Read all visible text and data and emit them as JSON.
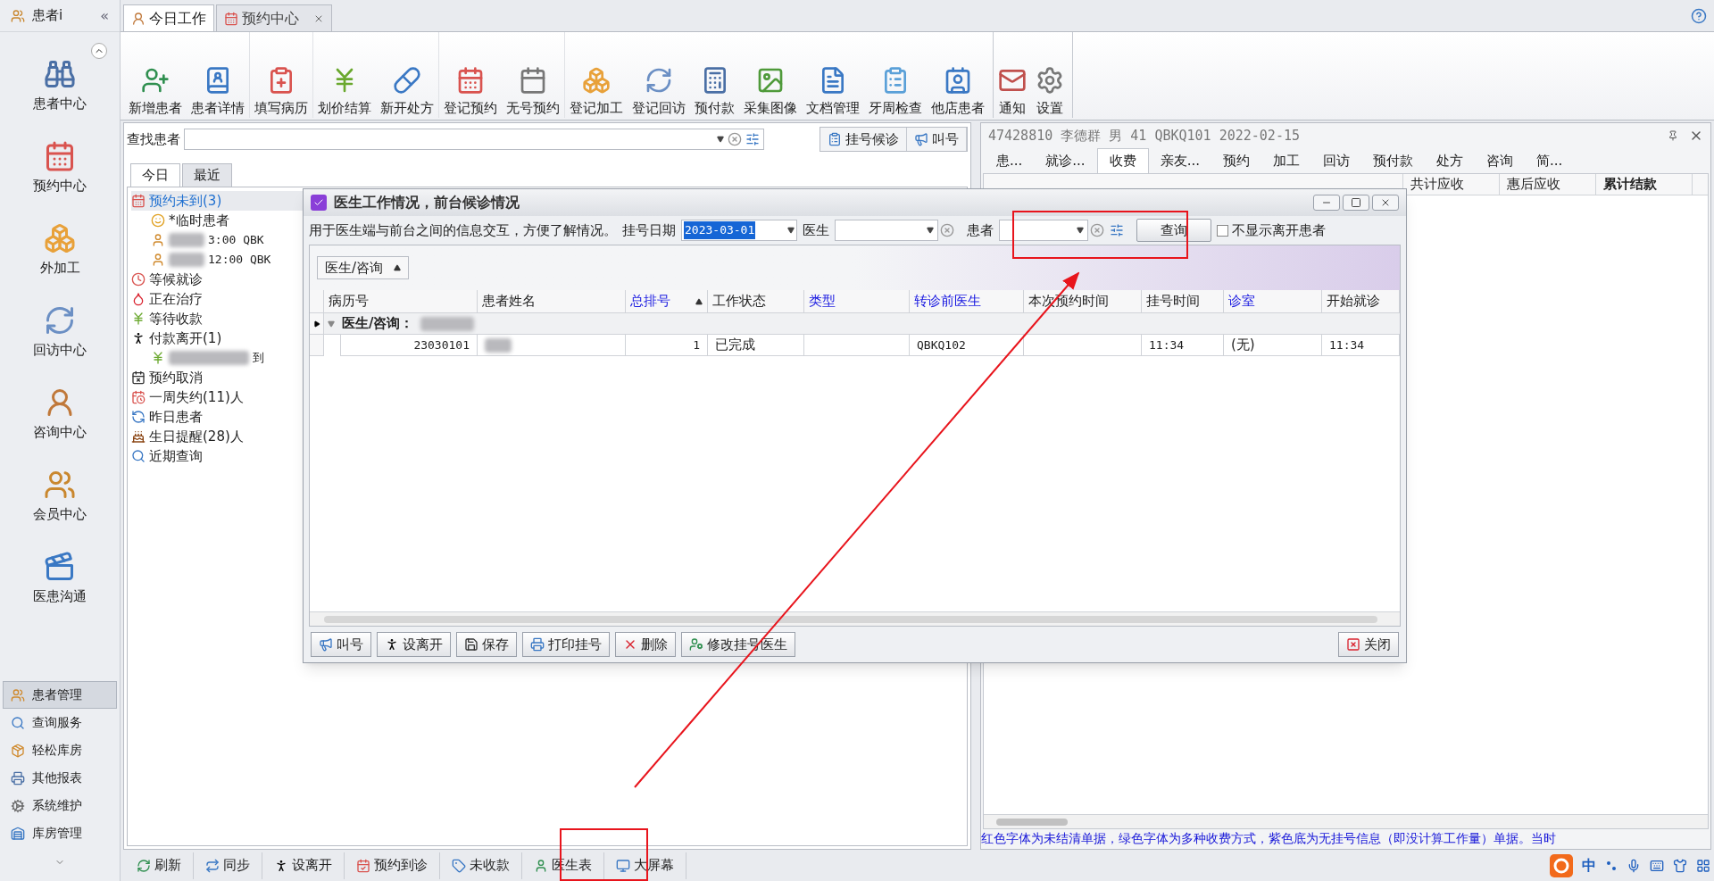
{
  "sidebar": {
    "title": "患者i",
    "collapse": "«",
    "nav": [
      {
        "label": "患者中心"
      },
      {
        "label": "预约中心"
      },
      {
        "label": "外加工"
      },
      {
        "label": "回访中心"
      },
      {
        "label": "咨询中心"
      },
      {
        "label": "会员中心"
      },
      {
        "label": "医患沟通"
      }
    ],
    "modules": [
      {
        "label": "患者管理",
        "selected": true
      },
      {
        "label": "查询服务",
        "selected": false
      },
      {
        "label": "轻松库房",
        "selected": false
      },
      {
        "label": "其他报表",
        "selected": false
      },
      {
        "label": "系统维护",
        "selected": false
      },
      {
        "label": "库房管理",
        "selected": false
      }
    ]
  },
  "doc_tabs": [
    {
      "label": "今日工作",
      "selected": true,
      "closable": false
    },
    {
      "label": "预约中心",
      "selected": false,
      "closable": true
    }
  ],
  "ribbon": [
    [
      "新增患者",
      "患者详情"
    ],
    [
      "填写病历"
    ],
    [
      "划价结算",
      "新开处方"
    ],
    [
      "登记预约",
      "无号预约"
    ],
    [
      "登记加工",
      "登记回访",
      "预付款",
      "采集图像",
      "文档管理",
      "牙周检查",
      "他店患者"
    ],
    [
      "通知",
      "设置"
    ]
  ],
  "left_panel": {
    "search_label": "查找患者",
    "buttons": [
      "挂号候诊",
      "叫号"
    ],
    "tabs": [
      {
        "label": "今日",
        "selected": true
      },
      {
        "label": "最近",
        "selected": false
      }
    ],
    "tree": [
      {
        "label": "预约未到(3)",
        "selected": true,
        "children": [
          {
            "label": "*临时患者",
            "blurred": false
          },
          {
            "label": "3:00 QBK",
            "blurred": true
          },
          {
            "label": "12:00 QBK",
            "blurred": true
          }
        ]
      },
      {
        "label": "等候就诊",
        "selected": false
      },
      {
        "label": "正在治疗",
        "selected": false
      },
      {
        "label": "等待收款",
        "selected": false
      },
      {
        "label": "付款离开(1)",
        "selected": false,
        "children": [
          {
            "label": "到",
            "blurred": true
          }
        ]
      },
      {
        "label": "预约取消",
        "selected": false
      },
      {
        "label": "一周失约(11)人",
        "selected": false
      },
      {
        "label": "昨日患者",
        "selected": false
      },
      {
        "label": "生日提醒(28)人",
        "selected": false
      },
      {
        "label": "近期查询",
        "selected": false
      }
    ]
  },
  "right_panel": {
    "title": "47428810 李德群 男 41 QBKQ101 2022-02-15",
    "tabs": [
      {
        "label": "患...",
        "selected": false
      },
      {
        "label": "就诊...",
        "selected": false
      },
      {
        "label": "收费",
        "selected": true
      },
      {
        "label": "亲友...",
        "selected": false
      },
      {
        "label": "预约",
        "selected": false
      },
      {
        "label": "加工",
        "selected": false
      },
      {
        "label": "回访",
        "selected": false
      },
      {
        "label": "预付款",
        "selected": false
      },
      {
        "label": "处方",
        "selected": false
      },
      {
        "label": "咨询",
        "selected": false
      },
      {
        "label": "简...",
        "selected": false
      }
    ],
    "columns": [
      {
        "label": "共计应收",
        "bold": false
      },
      {
        "label": "惠后应收",
        "bold": false
      },
      {
        "label": "累计结款",
        "bold": true
      }
    ],
    "status": "红色字体为未结清单据，绿色字体为多种收费方式，紫色底为无挂号信息（即没计算工作量）单据。当时"
  },
  "dialog": {
    "title": "医生工作情况，前台候诊情况",
    "description": "用于医生端与前台之间的信息交互，方便了解情况。",
    "date": {
      "label": "挂号日期",
      "value": "2023-03-01",
      "selected": true
    },
    "doctor_label": "医生",
    "patient_label": "患者",
    "query_button": "查询",
    "checkbox": {
      "label": "不显示离开患者",
      "checked": false
    },
    "group_by": "医生/咨询",
    "columns": [
      {
        "label": "病历号",
        "emphasized": false,
        "sorted": false
      },
      {
        "label": "患者姓名",
        "emphasized": false,
        "sorted": false
      },
      {
        "label": "总排号",
        "emphasized": true,
        "sorted": true
      },
      {
        "label": "工作状态",
        "emphasized": false,
        "sorted": false
      },
      {
        "label": "类型",
        "emphasized": true,
        "sorted": false
      },
      {
        "label": "转诊前医生",
        "emphasized": true,
        "sorted": false
      },
      {
        "label": "本次预约时间",
        "emphasized": false,
        "sorted": false
      },
      {
        "label": "挂号时间",
        "emphasized": false,
        "sorted": false
      },
      {
        "label": "诊室",
        "emphasized": true,
        "sorted": false
      },
      {
        "label": "开始就诊",
        "emphasized": false,
        "sorted": false
      }
    ],
    "group_row": "医生/咨询：",
    "rows": [
      [
        "23030101",
        "",
        "1",
        "已完成",
        "",
        "QBKQ102",
        "",
        "11:34",
        "(无)",
        "11:34"
      ]
    ],
    "buttons": [
      "叫号",
      "设离开",
      "保存",
      "打印挂号",
      "删除",
      "修改挂号医生"
    ],
    "close_button": "关闭"
  },
  "bottom_toolbar": [
    "刷新",
    "同步",
    "设离开",
    "预约到诊",
    "未收款",
    "医生表",
    "大屏幕"
  ],
  "tray": {
    "ime_mode": "中"
  }
}
